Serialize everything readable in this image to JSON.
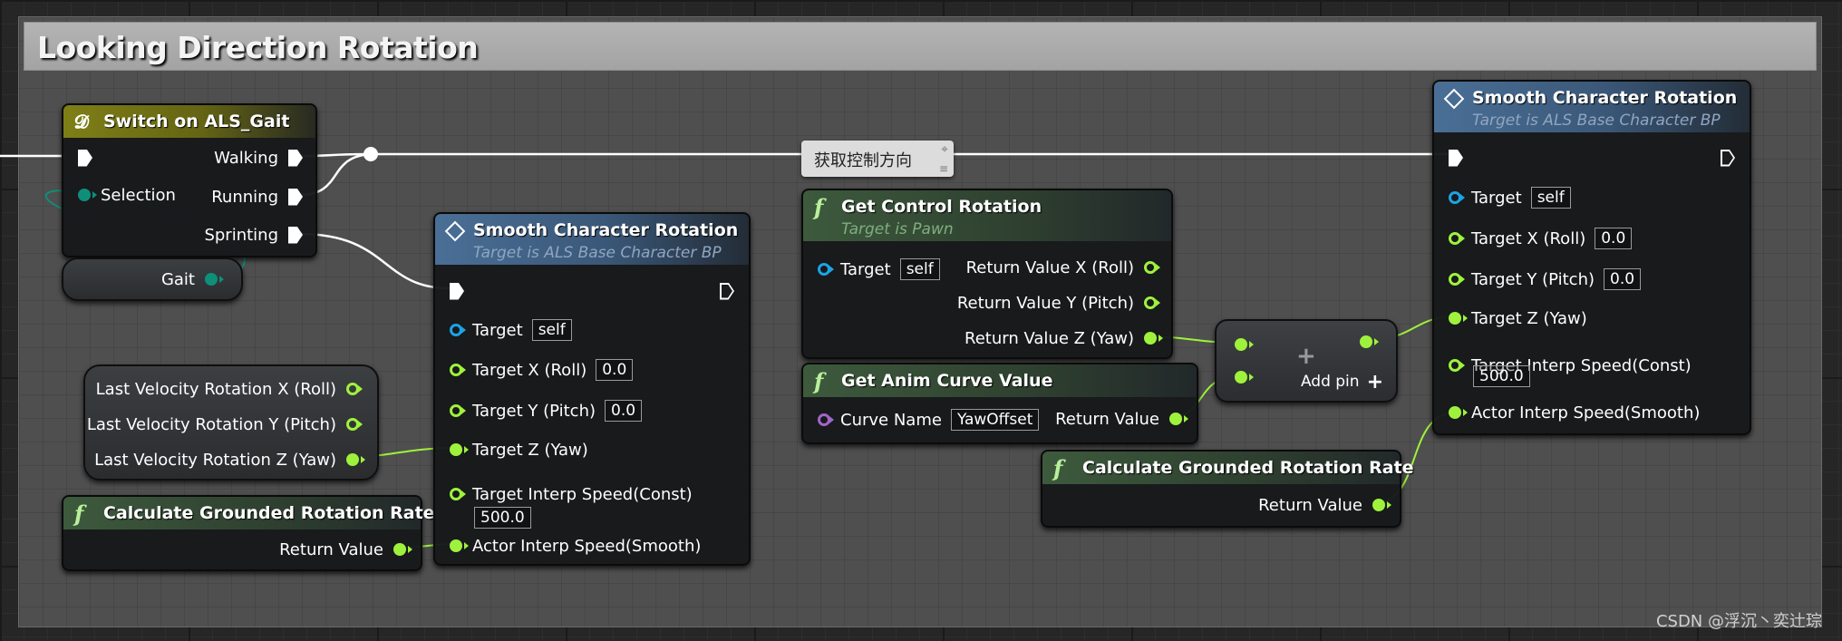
{
  "comment": {
    "title": "Looking Direction Rotation"
  },
  "switch_node": {
    "title": "Switch on ALS_Gait",
    "icon": "switch-icon",
    "outputs": [
      "Walking",
      "Running",
      "Sprinting"
    ],
    "selection_label": "Selection"
  },
  "gait_getter": {
    "label": "Gait"
  },
  "velocity_getter": {
    "items": [
      "Last Velocity Rotation X (Roll)",
      "Last Velocity Rotation Y (Pitch)",
      "Last Velocity Rotation Z (Yaw)"
    ]
  },
  "calc_rate_1": {
    "title": "Calculate Grounded Rotation Rate",
    "return_label": "Return Value"
  },
  "smooth_rot_1": {
    "title": "Smooth Character Rotation",
    "subtitle": "Target is ALS Base Character BP",
    "target_label": "Target",
    "target_value": "self",
    "x_label": "Target X (Roll)",
    "x_value": "0.0",
    "y_label": "Target Y (Pitch)",
    "y_value": "0.0",
    "z_label": "Target Z (Yaw)",
    "const_label": "Target Interp Speed(Const)",
    "const_value": "500.0",
    "smooth_label": "Actor Interp Speed(Smooth)"
  },
  "reroute": {
    "label": "获取控制方向"
  },
  "control_rot": {
    "title": "Get Control Rotation",
    "subtitle": "Target is Pawn",
    "target_label": "Target",
    "target_value": "self",
    "outputs": [
      "Return Value X (Roll)",
      "Return Value Y (Pitch)",
      "Return Value Z (Yaw)"
    ]
  },
  "anim_curve": {
    "title": "Get Anim Curve Value",
    "curve_label": "Curve Name",
    "curve_value": "YawOffset",
    "return_label": "Return Value"
  },
  "add_node": {
    "add_pin_label": "Add pin"
  },
  "calc_rate_2": {
    "title": "Calculate Grounded Rotation Rate",
    "return_label": "Return Value"
  },
  "smooth_rot_2": {
    "title": "Smooth Character Rotation",
    "subtitle": "Target is ALS Base Character BP",
    "target_label": "Target",
    "target_value": "self",
    "x_label": "Target X (Roll)",
    "x_value": "0.0",
    "y_label": "Target Y (Pitch)",
    "y_value": "0.0",
    "z_label": "Target Z (Yaw)",
    "const_label": "Target Interp Speed(Const)",
    "const_value": "500.0",
    "smooth_label": "Actor Interp Speed(Smooth)"
  },
  "watermark": "CSDN @浮沉丶奕辻琮",
  "colors": {
    "float_pin": "#9ff23c",
    "object_pin": "#1da3e6",
    "enum_pin": "#0e8f7a",
    "name_pin": "#a365c8",
    "exec_wire": "#ffffff"
  }
}
